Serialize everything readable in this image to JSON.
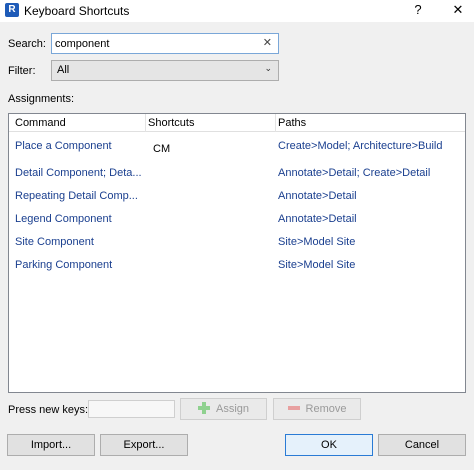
{
  "window": {
    "title": "Keyboard Shortcuts",
    "app_icon_letter": "R",
    "help_glyph": "?",
    "close_glyph": "✕"
  },
  "search": {
    "label": "Search:",
    "value": "component",
    "clear_glyph": "✕"
  },
  "filter": {
    "label": "Filter:",
    "value": "All",
    "chevron_glyph": "⌄"
  },
  "assignments": {
    "label": "Assignments:",
    "columns": [
      "Command",
      "Shortcuts",
      "Paths"
    ],
    "rows": [
      {
        "command": "Place a Component",
        "shortcut": "CM",
        "path": "Create>Model; Architecture>Build"
      },
      {
        "command": "Detail Component; Deta...",
        "shortcut": "",
        "path": "Annotate>Detail; Create>Detail"
      },
      {
        "command": "Repeating Detail Comp...",
        "shortcut": "",
        "path": "Annotate>Detail"
      },
      {
        "command": "Legend Component",
        "shortcut": "",
        "path": "Annotate>Detail"
      },
      {
        "command": "Site Component",
        "shortcut": "",
        "path": "Site>Model Site"
      },
      {
        "command": "Parking Component",
        "shortcut": "",
        "path": "Site>Model Site"
      }
    ]
  },
  "keys": {
    "label": "Press new keys:",
    "value": "",
    "assign_label": "Assign",
    "remove_label": "Remove"
  },
  "footer": {
    "import_label": "Import...",
    "export_label": "Export...",
    "ok_label": "OK",
    "cancel_label": "Cancel"
  },
  "colors": {
    "link_text": "#1a3f8f",
    "focus_border": "#7aa7d8",
    "default_button_border": "#2a7bd5"
  }
}
